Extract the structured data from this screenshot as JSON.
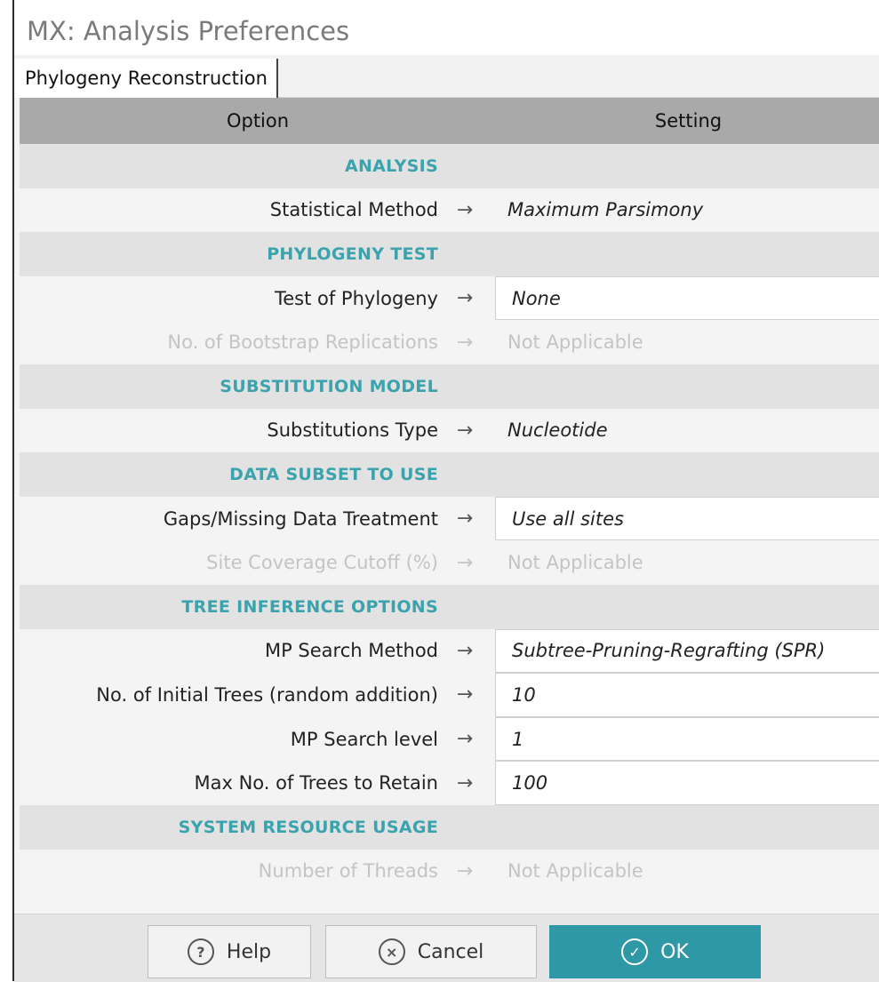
{
  "window": {
    "title": "MX: Analysis Preferences"
  },
  "tabs": [
    {
      "label": "Phylogeny Reconstruction"
    }
  ],
  "table": {
    "col_option": "Option",
    "col_setting": "Setting"
  },
  "rows": [
    {
      "kind": "section",
      "label": "ANALYSIS"
    },
    {
      "kind": "item",
      "label": "Statistical Method",
      "value": "Maximum Parsimony",
      "editable": false,
      "disabled": false
    },
    {
      "kind": "section",
      "label": "PHYLOGENY TEST"
    },
    {
      "kind": "item",
      "label": "Test of Phylogeny",
      "value": "None",
      "editable": true,
      "disabled": false
    },
    {
      "kind": "item",
      "label": "No. of Bootstrap Replications",
      "value": "Not Applicable",
      "editable": false,
      "disabled": true
    },
    {
      "kind": "section",
      "label": "SUBSTITUTION MODEL"
    },
    {
      "kind": "item",
      "label": "Substitutions Type",
      "value": "Nucleotide",
      "editable": false,
      "disabled": false
    },
    {
      "kind": "section",
      "label": "DATA SUBSET TO USE"
    },
    {
      "kind": "item",
      "label": "Gaps/Missing Data Treatment",
      "value": "Use all sites",
      "editable": true,
      "disabled": false
    },
    {
      "kind": "item",
      "label": "Site Coverage Cutoff (%)",
      "value": "Not Applicable",
      "editable": false,
      "disabled": true
    },
    {
      "kind": "section",
      "label": "TREE INFERENCE OPTIONS"
    },
    {
      "kind": "item",
      "label": "MP Search Method",
      "value": "Subtree-Pruning-Regrafting (SPR)",
      "editable": true,
      "disabled": false
    },
    {
      "kind": "item",
      "label": "No. of Initial Trees (random addition)",
      "value": "10",
      "editable": true,
      "disabled": false
    },
    {
      "kind": "item",
      "label": "MP Search level",
      "value": "1",
      "editable": true,
      "disabled": false
    },
    {
      "kind": "item",
      "label": "Max No. of Trees to Retain",
      "value": "100",
      "editable": true,
      "disabled": false
    },
    {
      "kind": "section",
      "label": "SYSTEM RESOURCE USAGE"
    },
    {
      "kind": "item",
      "label": "Number of Threads",
      "value": "Not Applicable",
      "editable": false,
      "disabled": true
    }
  ],
  "arrow_glyph": "→",
  "buttons": {
    "help": {
      "label": "Help",
      "icon": "?"
    },
    "cancel": {
      "label": "Cancel",
      "icon": "×"
    },
    "ok": {
      "label": "OK",
      "icon": "✓"
    }
  },
  "colors": {
    "accent": "#2f98a6",
    "section_text": "#3aa3ad"
  }
}
